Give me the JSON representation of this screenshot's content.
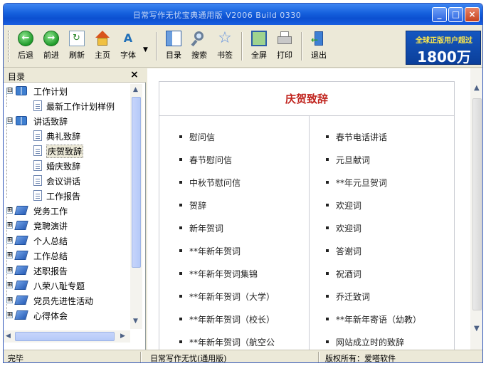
{
  "window": {
    "title": "日常写作无忧宝典通用版 V2006 Build 0330",
    "controls": {
      "minimize": "_",
      "maximize": "□",
      "close": "×"
    }
  },
  "toolbar": {
    "buttons": [
      {
        "label": "后退",
        "icon": "back-arrow-icon"
      },
      {
        "label": "前进",
        "icon": "forward-arrow-icon"
      },
      {
        "label": "刷新",
        "icon": "refresh-icon"
      },
      {
        "label": "主页",
        "icon": "home-icon"
      },
      {
        "label": "字体",
        "icon": "font-icon"
      },
      {
        "label": "目录",
        "icon": "toc-icon"
      },
      {
        "label": "搜索",
        "icon": "search-icon"
      },
      {
        "label": "书签",
        "icon": "bookmark-star-icon"
      },
      {
        "label": "全屏",
        "icon": "fullscreen-icon"
      },
      {
        "label": "打印",
        "icon": "printer-icon"
      },
      {
        "label": "退出",
        "icon": "exit-icon"
      }
    ],
    "font_dropdown": "▼",
    "promo": {
      "line1": "全球正版用户超过",
      "line2": "1800万"
    }
  },
  "sidebar": {
    "title": "目录",
    "close": "×",
    "tree": [
      {
        "label": "工作计划",
        "expander": "⊟",
        "kind": "open-book"
      },
      {
        "label": "最新工作计划样例",
        "kind": "page"
      },
      {
        "label": "讲话致辞",
        "expander": "⊟",
        "kind": "open-book"
      },
      {
        "label": "典礼致辞",
        "kind": "page"
      },
      {
        "label": "庆贺致辞",
        "kind": "page",
        "selected": true
      },
      {
        "label": "婚庆致辞",
        "kind": "page"
      },
      {
        "label": "会议讲话",
        "kind": "page"
      },
      {
        "label": "工作报告",
        "kind": "page"
      },
      {
        "label": "党务工作",
        "expander": "⊞",
        "kind": "book"
      },
      {
        "label": "竞聘演讲",
        "expander": "⊞",
        "kind": "book"
      },
      {
        "label": "个人总结",
        "expander": "⊞",
        "kind": "book"
      },
      {
        "label": "工作总结",
        "expander": "⊞",
        "kind": "book"
      },
      {
        "label": "述职报告",
        "expander": "⊞",
        "kind": "book"
      },
      {
        "label": "八荣八耻专题",
        "expander": "⊞",
        "kind": "book"
      },
      {
        "label": "党员先进性活动",
        "expander": "⊞",
        "kind": "book"
      },
      {
        "label": "心得体会",
        "expander": "⊞",
        "kind": "book"
      }
    ],
    "scroll": {
      "up": "▲",
      "down": "▼",
      "left": "◀",
      "right": "▶"
    }
  },
  "content": {
    "heading": "庆贺致辞",
    "left_items": [
      "慰问信",
      "春节慰问信",
      "中秋节慰问信",
      "贺辞",
      "新年贺词",
      "**年新年贺词",
      "**年新年贺词集锦",
      "**年新年贺词（大学）",
      "**年新年贺词（校长）",
      "**年新年贺词（航空公"
    ],
    "right_items": [
      "春节电话讲话",
      "元旦献词",
      "**年元旦贺词",
      "欢迎词",
      "欢迎词",
      "答谢词",
      "祝酒词",
      "乔迁致词",
      "**年新年寄语（幼教）",
      "网站成立时的致辞"
    ],
    "scroll": {
      "up": "▲",
      "down": "▼"
    }
  },
  "status": {
    "left": "完毕",
    "middle": "日常写作无忧(通用版)",
    "right": "版权所有：爱嗒软件"
  }
}
